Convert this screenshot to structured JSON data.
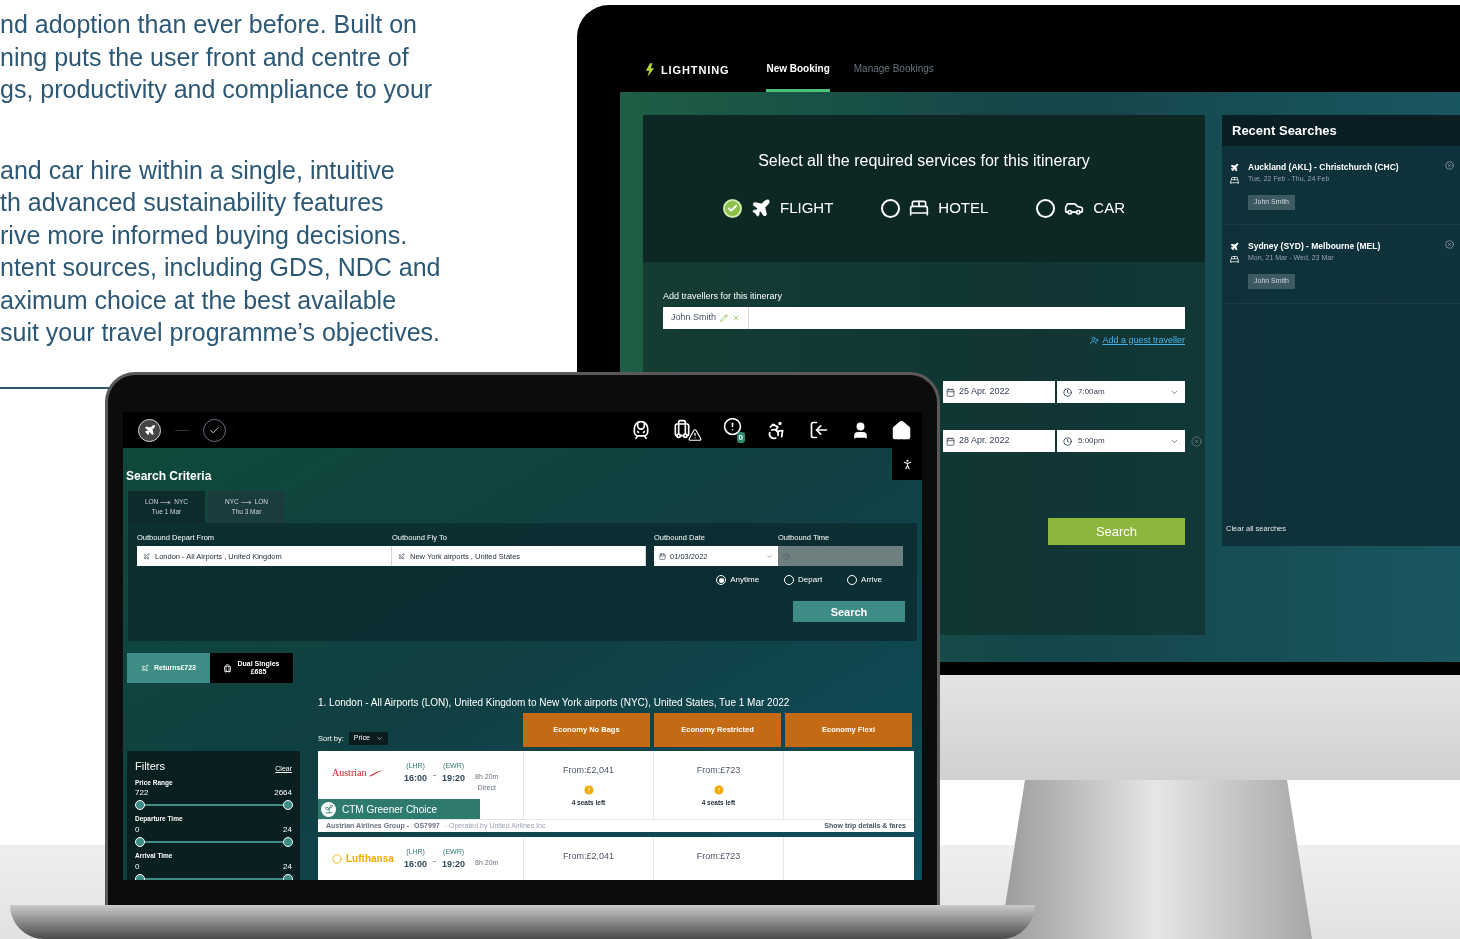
{
  "intro_text": {
    "paragraphs": [
      [
        "nd adoption than ever before. Built on",
        "ning puts the user front and centre of",
        "gs, productivity and compliance to your"
      ],
      [
        "and car hire within a single, intuitive",
        "th advanced sustainability features",
        "rive more informed buying decisions.",
        "ntent sources, including GDS, NDC and",
        "aximum choice at the best available",
        "suit your travel programme’s objectives."
      ]
    ]
  },
  "desktop_app": {
    "brand": "LIGHTNING",
    "nav_tabs": [
      {
        "label": "New Booking",
        "selected": true
      },
      {
        "label": "Manage Bookings",
        "selected": false
      }
    ],
    "services_title": "Select all the required services for this itinerary",
    "services": [
      {
        "kind": "flight",
        "label": "FLIGHT",
        "checked": true
      },
      {
        "kind": "hotel",
        "label": "HOTEL",
        "checked": false
      },
      {
        "kind": "car",
        "label": "CAR",
        "checked": false
      }
    ],
    "travellers_label": "Add travellers for this itinerary",
    "traveller_chips": [
      "John Smith"
    ],
    "guest_link": "Add a guest traveller",
    "date_rows": [
      {
        "date": "25 Apr. 2022",
        "time": "7:00am",
        "removable": false
      },
      {
        "date": "28 Apr. 2022",
        "time": "5:00pm",
        "removable": true
      }
    ],
    "search_button": "Search",
    "recent_searches": {
      "title": "Recent Searches",
      "items": [
        {
          "route": "Auckland (AKL) - Christchurch (CHC)",
          "dates": "Tue, 22 Feb - Thu, 24 Feb",
          "traveller": "John Smith"
        },
        {
          "route": "Sydney (SYD) - Melbourne (MEL)",
          "dates": "Mon, 21 Mar - Wed, 23 Mar",
          "traveller": "John Smith"
        }
      ],
      "clear_link": "Clear all searches"
    }
  },
  "web_app": {
    "alerts_count": "0",
    "search_criteria_title": "Search Criteria",
    "leg_tabs": [
      {
        "from": "LON",
        "to": "NYC",
        "date": "Tue 1 Mar",
        "selected": true
      },
      {
        "from": "NYC",
        "to": "LON",
        "date": "Thu 3 Mar",
        "selected": false
      }
    ],
    "fields": {
      "depart_from": {
        "label": "Outbound Depart From",
        "value": "London - All Airports , United Kingdom"
      },
      "fly_to": {
        "label": "Outbound Fly To",
        "value": "New York airports , United States"
      },
      "date": {
        "label": "Outbound Date",
        "value": "01/03/2022"
      },
      "time": {
        "label": "Outbound Time",
        "disabled": true
      }
    },
    "time_options": [
      {
        "label": "Anytime",
        "selected": true
      },
      {
        "label": "Depart",
        "selected": false
      },
      {
        "label": "Arrive",
        "selected": false
      }
    ],
    "search_button": "Search",
    "fare_tabs": [
      {
        "kind": "returns",
        "label": "Returns£723",
        "selected": true
      },
      {
        "kind": "singles",
        "label": "Dual Singles",
        "price": "£685",
        "selected": false
      }
    ],
    "results_heading": "1. London - All Airports (LON), United Kingdom to New York airports (NYC), United States, Tue 1 Mar 2022",
    "sort": {
      "label": "Sort by:",
      "value": "Price"
    },
    "fare_columns": [
      "Economy No Bags",
      "Economy Restricted",
      "Economy Flexi"
    ],
    "filters": {
      "title": "Filters",
      "clear": "Clear",
      "ranges": [
        {
          "label": "Price Range",
          "min": "722",
          "max": "2664",
          "level": 1
        },
        {
          "label": "Departure Time",
          "min": "0",
          "max": "24",
          "level": 1
        },
        {
          "label": "Arrival Time",
          "min": "0",
          "max": "24",
          "level": 1
        }
      ]
    },
    "results": [
      {
        "kind": "austrian",
        "airline": "Austrian",
        "from_code": "(LHR)",
        "depart": "16:00",
        "to_code": "(EWR)",
        "arrive": "19:20",
        "duration": "8h 20m",
        "stops": "Direct",
        "fares": [
          {
            "price": "From:£2,041",
            "seats": "4 seats left"
          },
          {
            "price": "From:£723",
            "seats": "4 seats left"
          }
        ],
        "greener_choice": "CTM Greener Choice",
        "operator": "Austrian Airlines Group -",
        "flight_no": "OS7997",
        "operated_by": "- Operated by United Airlines Inc",
        "details_link": "Show trip details & fares"
      },
      {
        "kind": "lufthansa",
        "airline": "Lufthansa",
        "from_code": "(LHR)",
        "depart": "16:00",
        "to_code": "(EWR)",
        "arrive": "19:20",
        "duration": "8h 20m",
        "fares": [
          {
            "price": "From:£2,041"
          },
          {
            "price": "From:£723"
          }
        ]
      }
    ]
  }
}
